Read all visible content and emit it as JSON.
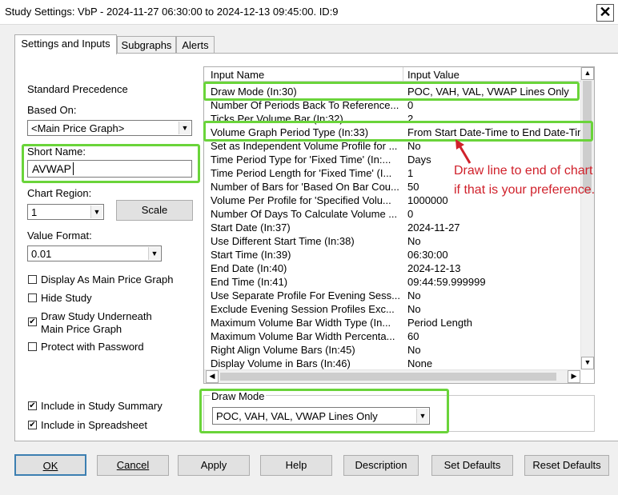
{
  "window": {
    "title": "Study Settings: VbP - 2024-11-27  06:30:00 to 2024-12-13  09:45:00. ID:9",
    "close_glyph": "✕"
  },
  "tabs": [
    {
      "label": "Settings and Inputs"
    },
    {
      "label": "Subgraphs"
    },
    {
      "label": "Alerts"
    }
  ],
  "left": {
    "standard_precedence": "Standard Precedence",
    "based_on_label": "Based On:",
    "based_on_value": "<Main Price Graph>",
    "short_name_label": "Short Name:",
    "short_name_value": "AVWAP",
    "chart_region_label": "Chart Region:",
    "chart_region_value": "1",
    "scale_button": "Scale",
    "value_format_label": "Value Format:",
    "value_format_value": "0.01",
    "checkboxes": [
      {
        "label": "Display As Main Price Graph",
        "checked": false
      },
      {
        "label": "Hide Study",
        "checked": false
      },
      {
        "label": "Draw Study Underneath\nMain Price Graph",
        "checked": true
      },
      {
        "label": "Protect with Password",
        "checked": false
      }
    ],
    "bottom_checkboxes": [
      {
        "label": "Include in Study Summary",
        "checked": true
      },
      {
        "label": "Include in Spreadsheet",
        "checked": true
      }
    ]
  },
  "grid": {
    "col_name": "Input Name",
    "col_value": "Input Value",
    "rows": [
      {
        "name": "Draw Mode   (In:30)",
        "value": "POC, VAH, VAL, VWAP Lines Only"
      },
      {
        "name": "Number Of Periods Back To Reference...",
        "value": "0"
      },
      {
        "name": "Ticks Per Volume Bar   (In:32)",
        "value": "2"
      },
      {
        "name": "Volume Graph Period Type   (In:33)",
        "value": "From Start Date-Time to End Date-Time"
      },
      {
        "name": "Set as Independent Volume Profile for ...",
        "value": "No"
      },
      {
        "name": "Time Period Type for 'Fixed Time'   (In:...",
        "value": "Days"
      },
      {
        "name": "Time Period Length for 'Fixed Time'   (I...",
        "value": "1"
      },
      {
        "name": "Number of Bars for 'Based On Bar Cou...",
        "value": "50"
      },
      {
        "name": "Volume Per Profile for 'Specified Volu...",
        "value": "1000000"
      },
      {
        "name": "Number Of Days To Calculate Volume ...",
        "value": "0"
      },
      {
        "name": "Start Date   (In:37)",
        "value": "2024-11-27"
      },
      {
        "name": "Use Different Start Time   (In:38)",
        "value": "No"
      },
      {
        "name": "Start Time   (In:39)",
        "value": "06:30:00"
      },
      {
        "name": "End Date   (In:40)",
        "value": "2024-12-13"
      },
      {
        "name": "End Time   (In:41)",
        "value": "09:44:59.999999"
      },
      {
        "name": "Use Separate Profile For Evening Sess...",
        "value": "No"
      },
      {
        "name": "Exclude Evening Session Profiles Exc...",
        "value": "No"
      },
      {
        "name": "Maximum Volume Bar Width Type   (In...",
        "value": "Period Length"
      },
      {
        "name": "Maximum Volume Bar Width Percenta...",
        "value": "60"
      },
      {
        "name": "Right Align Volume Bars   (In:45)",
        "value": "No"
      },
      {
        "name": "Display Volume in Bars   (In:46)",
        "value": "None"
      }
    ]
  },
  "annotation": {
    "line1": "Draw line to end of chart",
    "line2": "if that is your preference."
  },
  "draw_mode": {
    "label": "Draw Mode",
    "value": "POC, VAH, VAL, VWAP Lines Only"
  },
  "buttons": [
    {
      "label": "OK"
    },
    {
      "label": "Cancel"
    },
    {
      "label": "Apply"
    },
    {
      "label": "Help"
    },
    {
      "label": "Description"
    },
    {
      "label": "Set Defaults"
    },
    {
      "label": "Reset Defaults"
    }
  ],
  "colors": {
    "highlight": "#6ad43a",
    "annotation": "#d0212b"
  }
}
